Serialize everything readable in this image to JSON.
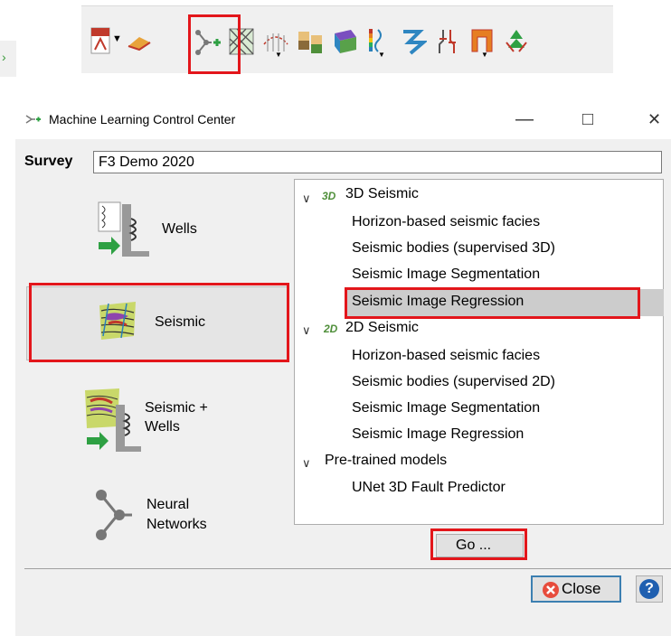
{
  "dialog": {
    "title": "Machine Learning Control Center",
    "minimize_glyph": "—",
    "maximize_glyph": "□",
    "close_glyph": "✕"
  },
  "survey": {
    "label": "Survey",
    "value": "F3 Demo 2020"
  },
  "categories": [
    {
      "label": "Wells"
    },
    {
      "label": "Seismic"
    },
    {
      "label": "Seismic +\nWells"
    },
    {
      "label": "Neural\nNetworks"
    }
  ],
  "tree": {
    "groups": [
      {
        "badge": "3D",
        "label": "3D Seismic",
        "items": [
          "Horizon-based seismic facies",
          "Seismic bodies (supervised 3D)",
          "Seismic Image Segmentation",
          "Seismic Image Regression"
        ]
      },
      {
        "badge": "2D",
        "label": "2D Seismic",
        "items": [
          "Horizon-based seismic facies",
          "Seismic bodies (supervised 2D)",
          "Seismic Image Segmentation",
          "Seismic Image Regression"
        ]
      },
      {
        "badge": "",
        "label": "Pre-trained models",
        "items": [
          "UNet 3D Fault Predictor"
        ]
      }
    ]
  },
  "buttons": {
    "go": "Go ...",
    "close": "Close",
    "help": "?"
  },
  "colors": {
    "highlight_red": "#e3161b",
    "selection_gray": "#cccccc",
    "dialog_bg": "#f0f0f0"
  }
}
